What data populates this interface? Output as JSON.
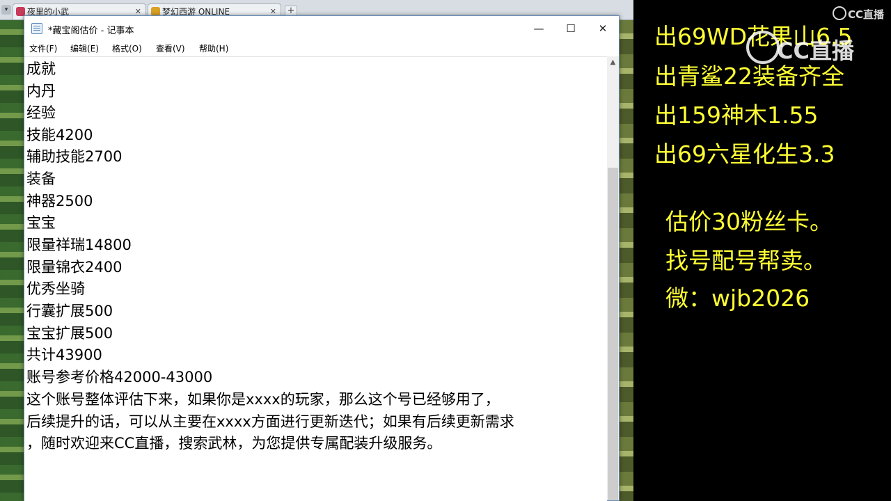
{
  "browser": {
    "tabs": [
      {
        "label": "夜里的小武"
      },
      {
        "label": "梦幻西游 ONLINE"
      }
    ],
    "add_tab": "+",
    "nav_arrow": "▾"
  },
  "notepad": {
    "title": "*藏宝阁估价 - 记事本",
    "window_buttons": {
      "minimize": "—",
      "maximize": "☐",
      "close": "✕"
    },
    "menu": [
      "文件(F)",
      "编辑(E)",
      "格式(O)",
      "查看(V)",
      "帮助(H)"
    ],
    "lines": [
      "成就",
      "内丹",
      "经验",
      "技能4200",
      "辅助技能2700",
      "装备",
      "神器2500",
      "宝宝",
      "限量祥瑞14800",
      "限量锦衣2400",
      "优秀坐骑",
      "行囊扩展500",
      "宝宝扩展500",
      "共计43900",
      "账号参考价格42000-43000",
      "这个账号整体评估下来，如果你是xxxx的玩家，那么这个号已经够用了，",
      "后续提升的话，可以从主要在xxxx方面进行更新迭代；如果有后续更新需求",
      "，随时欢迎来CC直播，搜索武林，为您提供专属配装升级服务。"
    ],
    "scroll_up": "▲"
  },
  "overlay": {
    "sales": [
      "出69WD花果山6.5",
      "出青鲨22装备齐全",
      "出159神木1.55",
      "出69六星化生3.3"
    ],
    "notes": [
      "估价30粉丝卡。",
      "找号配号帮卖。",
      "微：wjb2026"
    ],
    "text_color": "#ffff33",
    "watermark_small": "CC直播",
    "watermark_large": "CC直播"
  }
}
